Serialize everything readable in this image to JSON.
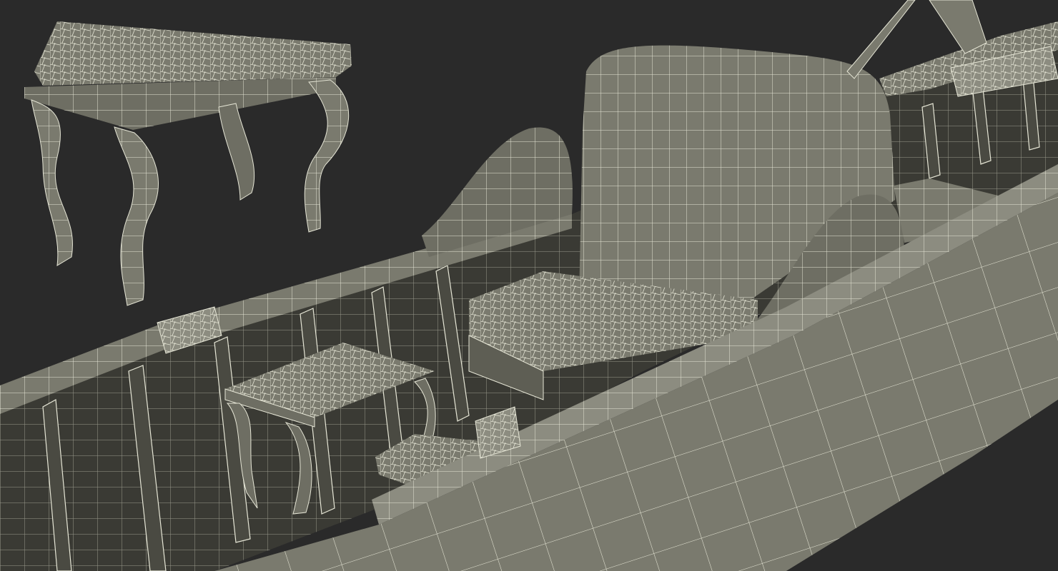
{
  "scene": {
    "background": "#2a2a2a",
    "mesh_fill": "#7a7a6e",
    "mesh_fill_dark": "#5e5e54",
    "mesh_fill_light": "#8c8c80",
    "wire_color": "#e6e6d6",
    "interior_color": "#3a3a34"
  }
}
